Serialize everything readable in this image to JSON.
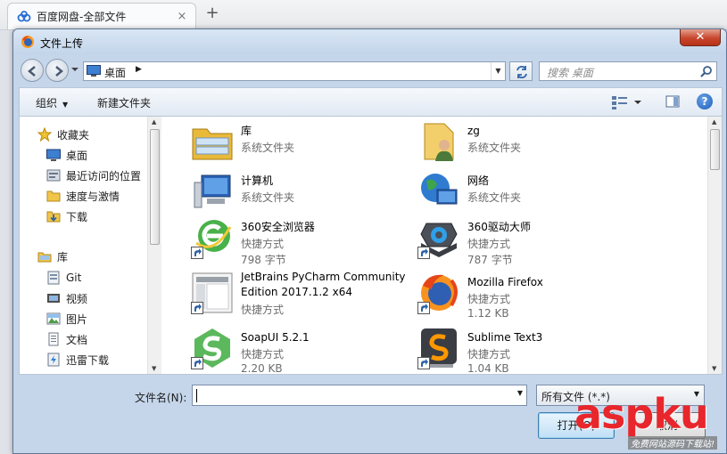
{
  "browser": {
    "tab_title": "百度网盘-全部文件",
    "tab_close": "×",
    "new_tab": "+"
  },
  "dialog": {
    "title": "文件上传",
    "close": "✕"
  },
  "address": {
    "location": "桌面",
    "search_placeholder": "搜索 桌面"
  },
  "toolbar": {
    "organize": "组织",
    "new_folder": "新建文件夹"
  },
  "nav": {
    "favorites_header": "收藏夹",
    "favorites": [
      {
        "label": "桌面",
        "icon": "desktop-icon"
      },
      {
        "label": "最近访问的位置",
        "icon": "recent-places-icon"
      },
      {
        "label": "速度与激情",
        "icon": "folder-icon"
      },
      {
        "label": "下载",
        "icon": "downloads-icon"
      }
    ],
    "libraries_header": "库",
    "libraries": [
      {
        "label": "Git",
        "icon": "git-library-icon"
      },
      {
        "label": "视频",
        "icon": "videos-icon"
      },
      {
        "label": "图片",
        "icon": "pictures-icon"
      },
      {
        "label": "文档",
        "icon": "documents-icon"
      },
      {
        "label": "迅雷下载",
        "icon": "thunder-download-icon"
      }
    ]
  },
  "files": [
    {
      "name": "库",
      "type": "系统文件夹",
      "size": "",
      "icon": "library-icon"
    },
    {
      "name": "zg",
      "type": "系统文件夹",
      "size": "",
      "icon": "user-folder-icon"
    },
    {
      "name": "计算机",
      "type": "系统文件夹",
      "size": "",
      "icon": "computer-icon"
    },
    {
      "name": "网络",
      "type": "系统文件夹",
      "size": "",
      "icon": "network-icon"
    },
    {
      "name": "360安全浏览器",
      "type": "快捷方式",
      "size": "798 字节",
      "icon": "360-browser-icon"
    },
    {
      "name": "360驱动大师",
      "type": "快捷方式",
      "size": "787 字节",
      "icon": "360-driver-icon"
    },
    {
      "name": "JetBrains PyCharm Community Edition 2017.1.2 x64",
      "type": "快捷方式",
      "size": "",
      "icon": "pycharm-icon"
    },
    {
      "name": "Mozilla Firefox",
      "type": "快捷方式",
      "size": "1.12 KB",
      "icon": "firefox-icon"
    },
    {
      "name": "SoapUI 5.2.1",
      "type": "快捷方式",
      "size": "2.20 KB",
      "icon": "soapui-icon"
    },
    {
      "name": "Sublime Text3",
      "type": "快捷方式",
      "size": "1.04 KB",
      "icon": "sublime-icon"
    }
  ],
  "bottom": {
    "filename_label": "文件名(N):",
    "filename_value": "",
    "filter": "所有文件 (*.*)",
    "open_button": "打开(O)",
    "cancel_button": "取消"
  },
  "watermark": {
    "logo": "aspku",
    "subtitle": "免费网站源码下载站!"
  },
  "colors": {
    "accent": "#3c7fb1",
    "close_red": "#c7452c",
    "watermark_red": "#e8262b"
  }
}
